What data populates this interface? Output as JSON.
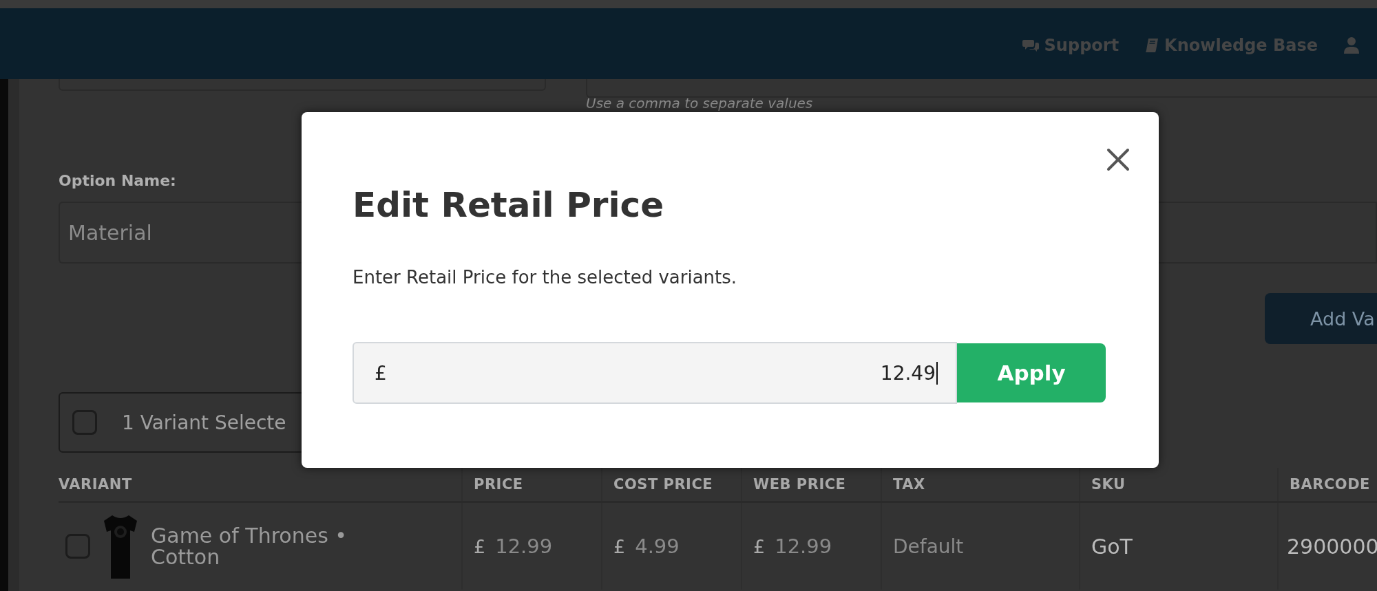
{
  "header": {
    "links": [
      {
        "label": "Support"
      },
      {
        "label": "Knowledge Base"
      }
    ]
  },
  "form": {
    "hint": "Use a comma to separate values",
    "option_label": "Option Name:",
    "option_placeholder": "Material",
    "add_button": "Add Va"
  },
  "selection": {
    "checked": false,
    "label": "1 Variant Selecte"
  },
  "table": {
    "columns": [
      "VARIANT",
      "PRICE",
      "COST PRICE",
      "WEB PRICE",
      "TAX",
      "SKU",
      "BARCODE"
    ],
    "rows": [
      {
        "checked": false,
        "variant": "Game of Thrones • Cotton",
        "price": {
          "currency": "£",
          "value": "12.99"
        },
        "cost_price": {
          "currency": "£",
          "value": "4.99"
        },
        "web_price": {
          "currency": "£",
          "value": "12.99"
        },
        "tax": "Default",
        "sku": "GoT",
        "barcode": "2900000"
      }
    ]
  },
  "modal": {
    "title": "Edit Retail Price",
    "text": "Enter Retail Price for the selected variants.",
    "currency": "£",
    "value": "12.49",
    "button": "Apply"
  }
}
